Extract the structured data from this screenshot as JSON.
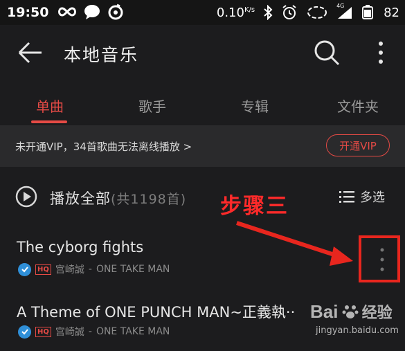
{
  "status_bar": {
    "time": "19:50",
    "net_speed": "0.10",
    "net_unit": "K/s",
    "signal_label": "4G",
    "battery": "82"
  },
  "toolbar": {
    "title": "本地音乐",
    "back_icon": "arrow-left-icon",
    "search_icon": "search-icon",
    "more_icon": "more-vertical-icon"
  },
  "tabs": [
    {
      "label": "单曲",
      "active": true
    },
    {
      "label": "歌手",
      "active": false
    },
    {
      "label": "专辑",
      "active": false
    },
    {
      "label": "文件夹",
      "active": false
    }
  ],
  "vip_banner": {
    "text": "未开通VIP，34首歌曲无法离线播放",
    "chevron": ">",
    "button_label": "开通VIP"
  },
  "play_all": {
    "label": "播放全部",
    "count": "(共1198首)",
    "multi_select_label": "多选"
  },
  "songs": [
    {
      "title": "The cyborg fights",
      "quality": "HQ",
      "artist": "宫崎誠",
      "album": "ONE TAKE MAN"
    },
    {
      "title": "A Theme of ONE PUNCH MAN~正義執··",
      "quality": "HQ",
      "artist": "宫崎誠",
      "album": "ONE TAKE MAN"
    }
  ],
  "annotation": {
    "text": "步骤三"
  },
  "watermark": {
    "brand_latin": "Bai",
    "brand_cn": "经验",
    "url": "jingyan.baidu.com"
  },
  "colors": {
    "accent": "#e54a45",
    "background": "#1c1c1e",
    "check_blue": "#2f8fd8",
    "annotation_red": "#e8261e"
  }
}
